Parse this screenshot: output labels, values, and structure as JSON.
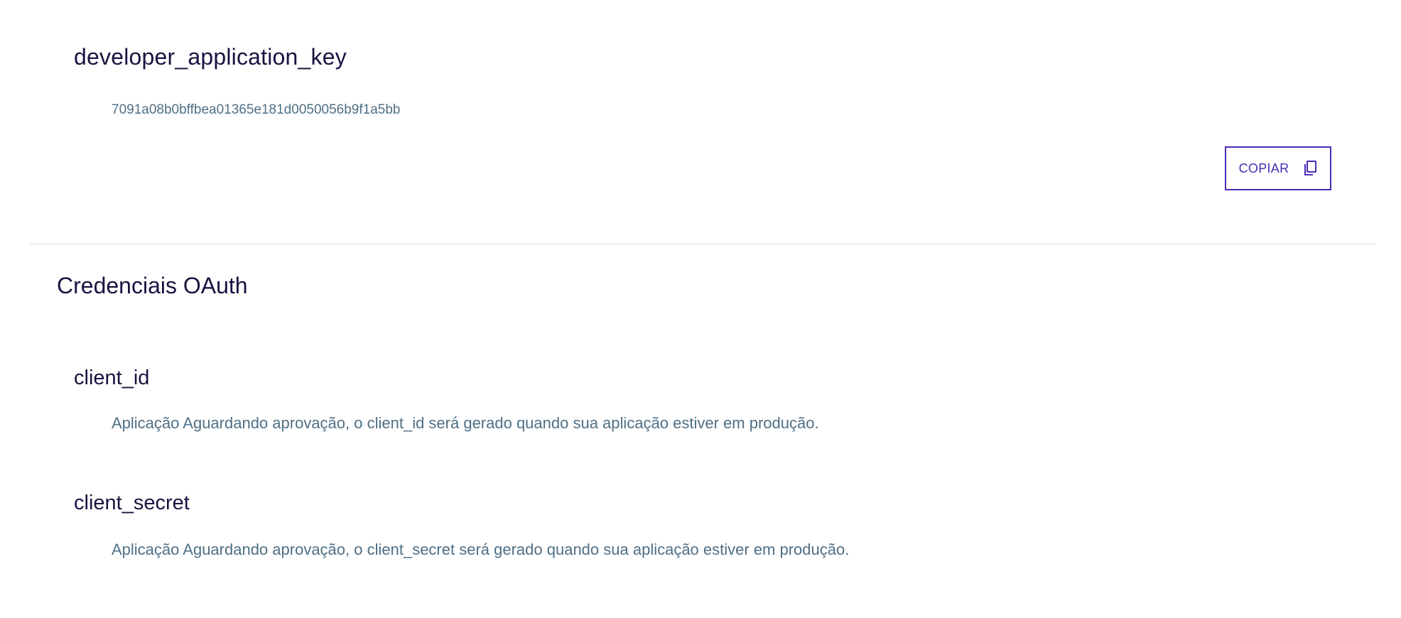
{
  "developer_key": {
    "title": "developer_application_key",
    "value": "7091a08b0bffbea01365e181d0050056b9f1a5bb",
    "copy_label": "COPIAR",
    "copy_icon": "copy-icon"
  },
  "oauth": {
    "section_title": "Credenciais OAuth",
    "client_id": {
      "title": "client_id",
      "description": "Aplicação Aguardando aprovação, o client_id será gerado quando sua aplicação estiver em produção."
    },
    "client_secret": {
      "title": "client_secret",
      "description": "Aplicação Aguardando aprovação, o client_secret será gerado quando sua aplicação estiver em produção."
    }
  },
  "colors": {
    "heading": "#1b1240",
    "muted_text": "#4f6f85",
    "accent": "#4b2bb8",
    "divider": "#d9d9de"
  }
}
